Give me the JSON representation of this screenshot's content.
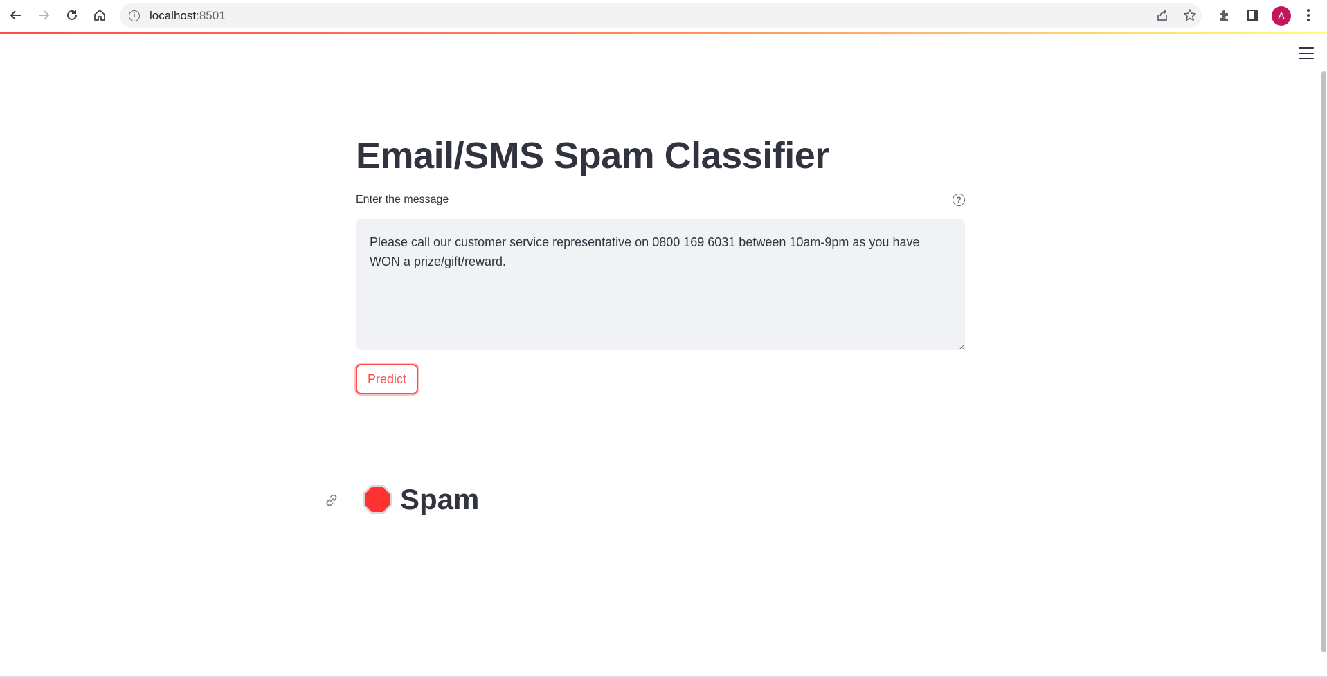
{
  "browser": {
    "url_host": "localhost",
    "url_port": ":8501",
    "profile_initial": "A"
  },
  "app": {
    "title": "Email/SMS Spam Classifier",
    "input_label": "Enter the message",
    "message_value": "Please call our customer service representative on 0800 169 6031 between 10am-9pm as you have WON a prize/gift/reward.",
    "predict_label": "Predict",
    "result_text": "Spam",
    "result_emoji": "stop-sign-icon"
  },
  "colors": {
    "accent": "#ff4b4b",
    "text": "#31333f",
    "input_bg": "#f0f2f6",
    "stop_sign": "#ff3131",
    "avatar": "#c2185b"
  }
}
